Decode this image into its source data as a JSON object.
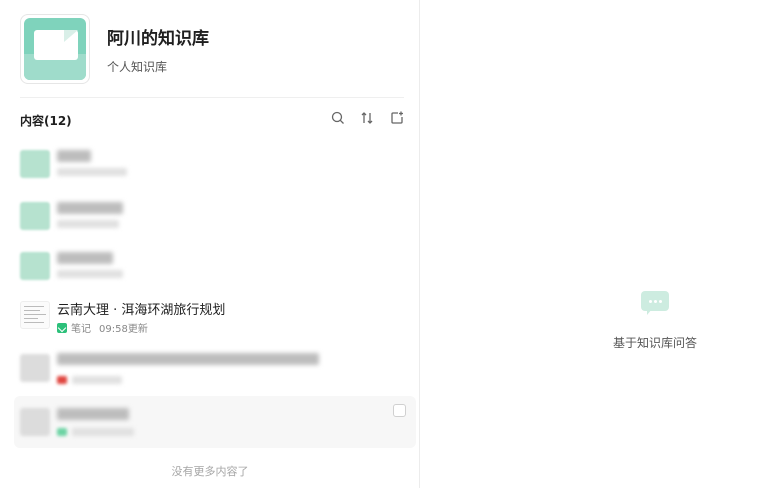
{
  "knowledge_base": {
    "title": "阿川的知识库",
    "subtitle": "个人知识库",
    "cover_icon": "document-cover-icon",
    "accent_color": "#7fd3bc"
  },
  "content": {
    "header": "内容(12)",
    "tools": [
      {
        "name": "search-icon"
      },
      {
        "name": "sort-icon"
      },
      {
        "name": "add-note-icon"
      }
    ],
    "items": [
      {
        "visible": false
      },
      {
        "visible": false
      },
      {
        "visible": false
      },
      {
        "visible": true,
        "title": "云南大理 · 洱海环湖旅行规划",
        "type": "笔记",
        "time": "09:58更新",
        "type_color": "#2cc07a"
      },
      {
        "visible": false
      },
      {
        "visible": false
      }
    ],
    "footer": "没有更多内容了"
  },
  "qa": {
    "label": "基于知识库问答",
    "icon": "chat-bubble-icon"
  }
}
